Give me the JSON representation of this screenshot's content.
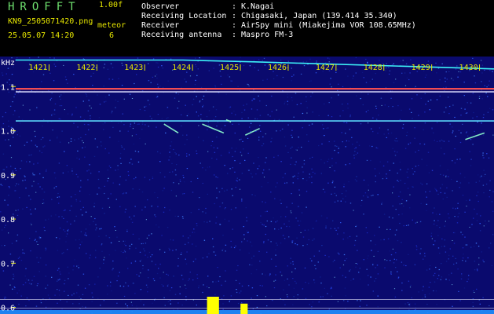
{
  "header": {
    "app_title": "HROFFT",
    "version": "1.00f",
    "filename": "KN9_2505071420.png",
    "timestamp": "25.05.07 14:20",
    "meteor_label": "meteor",
    "meteor_count": "6"
  },
  "metadata": [
    {
      "key": "Observer",
      "value": "K.Nagai"
    },
    {
      "key": "Receiving Location",
      "value": "Chigasaki, Japan (139.414 35.340)"
    },
    {
      "key": "Receiver",
      "value": "AirSpy mini (Miakejima VOR 108.65MHz)"
    },
    {
      "key": "Receiving antenna",
      "value": "Maspro FM-3"
    }
  ],
  "chart_data": {
    "type": "heatmap",
    "title": "",
    "xlabel": "",
    "ylabel": "kHz",
    "x_ticks": [
      "1421",
      "1422",
      "1423",
      "1424",
      "1425",
      "1426",
      "1427",
      "1428",
      "1429",
      "1430"
    ],
    "y_ticks": [
      "1.1",
      "1.0",
      "0.9",
      "0.8",
      "0.7",
      "0.6"
    ],
    "y_values": [
      1.1,
      1.0,
      0.9,
      0.8,
      0.7,
      0.6
    ],
    "ylim": [
      0.585,
      1.168
    ],
    "xlim": [
      1420.5,
      1430.5
    ],
    "background_color": "#0a0a6e",
    "traces": [
      {
        "kind": "drift-carrier",
        "x": [
          1420.5,
          1424,
          1425.5,
          1430.5
        ],
        "y": [
          1.16,
          1.16,
          1.156,
          1.14
        ],
        "color": "#40ffff"
      },
      {
        "kind": "carrier",
        "x": [
          1420.5,
          1430.5
        ],
        "y": [
          1.095,
          1.095
        ],
        "color": "#ff5050"
      },
      {
        "kind": "carrier",
        "x": [
          1420.5,
          1430.5
        ],
        "y": [
          1.088,
          1.088
        ],
        "color": "#e0e0ff"
      },
      {
        "kind": "carrier",
        "x": [
          1420.5,
          1430.5
        ],
        "y": [
          1.022,
          1.022
        ],
        "color": "#5fe0ff"
      }
    ],
    "meteor_echoes": [
      {
        "x": [
          1424.4,
          1424.85
        ],
        "y": [
          1.015,
          0.995
        ]
      },
      {
        "x": [
          1424.9,
          1425.0
        ],
        "y": [
          1.025,
          1.02
        ]
      },
      {
        "x": [
          1425.3,
          1425.6
        ],
        "y": [
          0.99,
          1.005
        ]
      },
      {
        "x": [
          1423.6,
          1423.9
        ],
        "y": [
          1.015,
          0.995
        ]
      },
      {
        "x": [
          1429.9,
          1430.3
        ],
        "y": [
          0.98,
          0.995
        ]
      }
    ],
    "activity_bars": [
      {
        "x": [
          1424.5,
          1424.75
        ],
        "level": 1.0,
        "color": "#ffff00"
      },
      {
        "x": [
          1425.2,
          1425.35
        ],
        "level": 0.6,
        "color": "#ffff00"
      }
    ],
    "reference_lines": [
      0.618,
      0.598
    ]
  }
}
